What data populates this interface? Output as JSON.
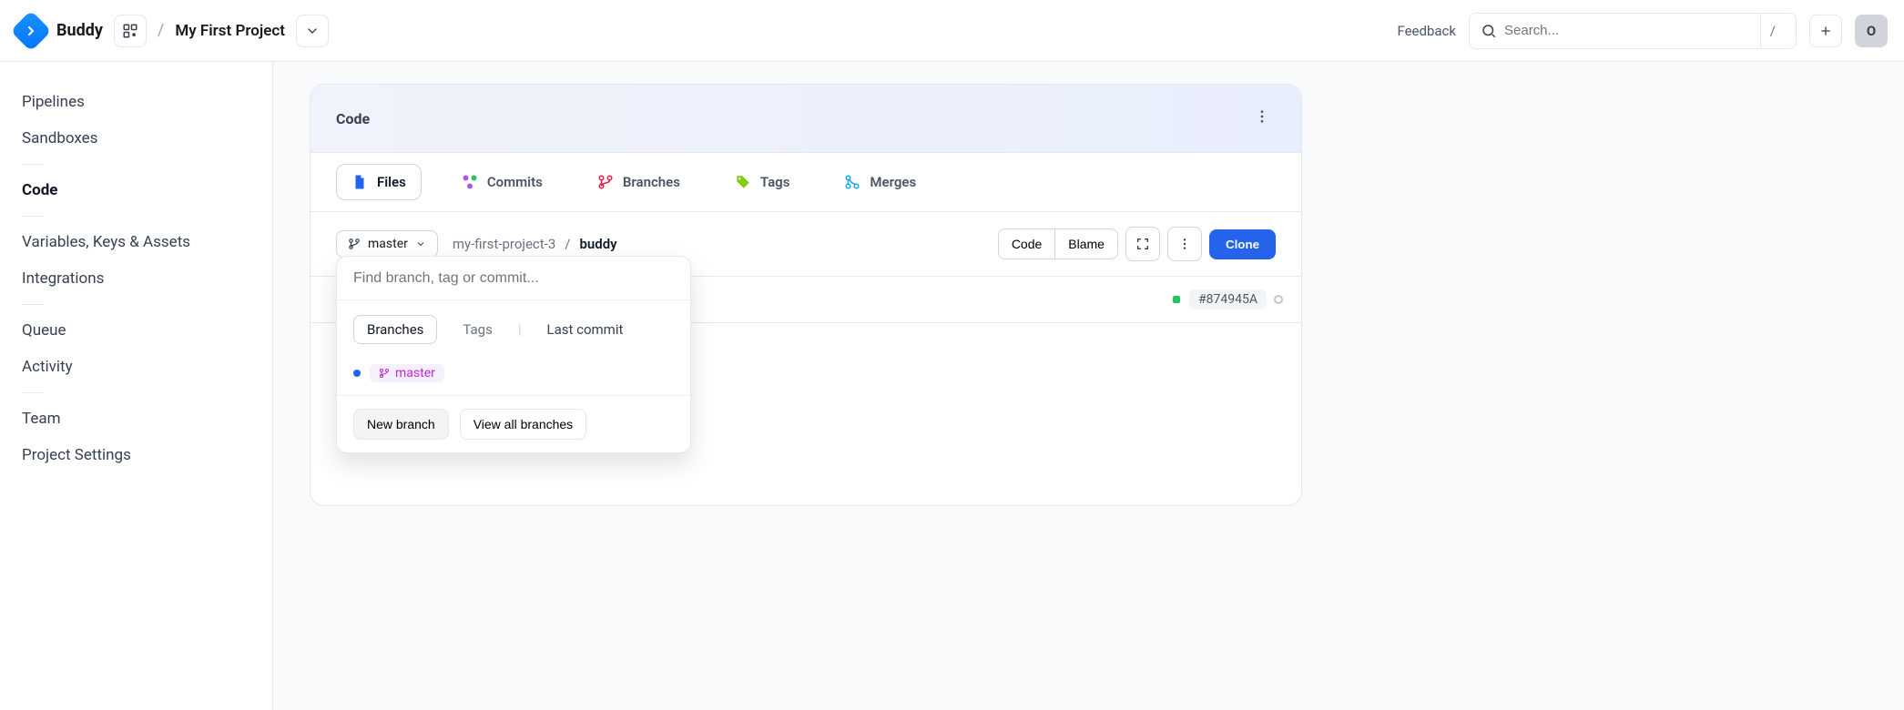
{
  "header": {
    "brand": "Buddy",
    "project": "My First Project",
    "feedback": "Feedback",
    "search_placeholder": "Search...",
    "kbd": "/",
    "avatar_initial": "O"
  },
  "sidebar": {
    "items": [
      {
        "label": "Pipelines",
        "active": false
      },
      {
        "label": "Sandboxes",
        "active": false
      },
      {
        "label": "Code",
        "active": true
      },
      {
        "label": "Variables, Keys & Assets",
        "active": false
      },
      {
        "label": "Integrations",
        "active": false
      },
      {
        "label": "Queue",
        "active": false
      },
      {
        "label": "Activity",
        "active": false
      },
      {
        "label": "Team",
        "active": false
      },
      {
        "label": "Project Settings",
        "active": false
      }
    ]
  },
  "panel": {
    "title": "Code",
    "tabs": [
      {
        "label": "Files",
        "icon": "file-icon",
        "active": true
      },
      {
        "label": "Commits",
        "icon": "commits-icon",
        "active": false
      },
      {
        "label": "Branches",
        "icon": "branches-icon",
        "active": false
      },
      {
        "label": "Tags",
        "icon": "tags-icon",
        "active": false
      },
      {
        "label": "Merges",
        "icon": "merges-icon",
        "active": false
      }
    ]
  },
  "toolbar": {
    "branch": "master",
    "crumbs": [
      "my-first-project-3",
      "buddy"
    ],
    "code": "Code",
    "blame": "Blame",
    "clone": "Clone",
    "file_hash": "#874945A"
  },
  "dropdown": {
    "search_placeholder": "Find branch, tag or commit...",
    "tabs": [
      "Branches",
      "Tags",
      "Last commit"
    ],
    "active_tab": "Branches",
    "branches": [
      "master"
    ],
    "new_branch": "New branch",
    "view_all": "View all branches"
  }
}
